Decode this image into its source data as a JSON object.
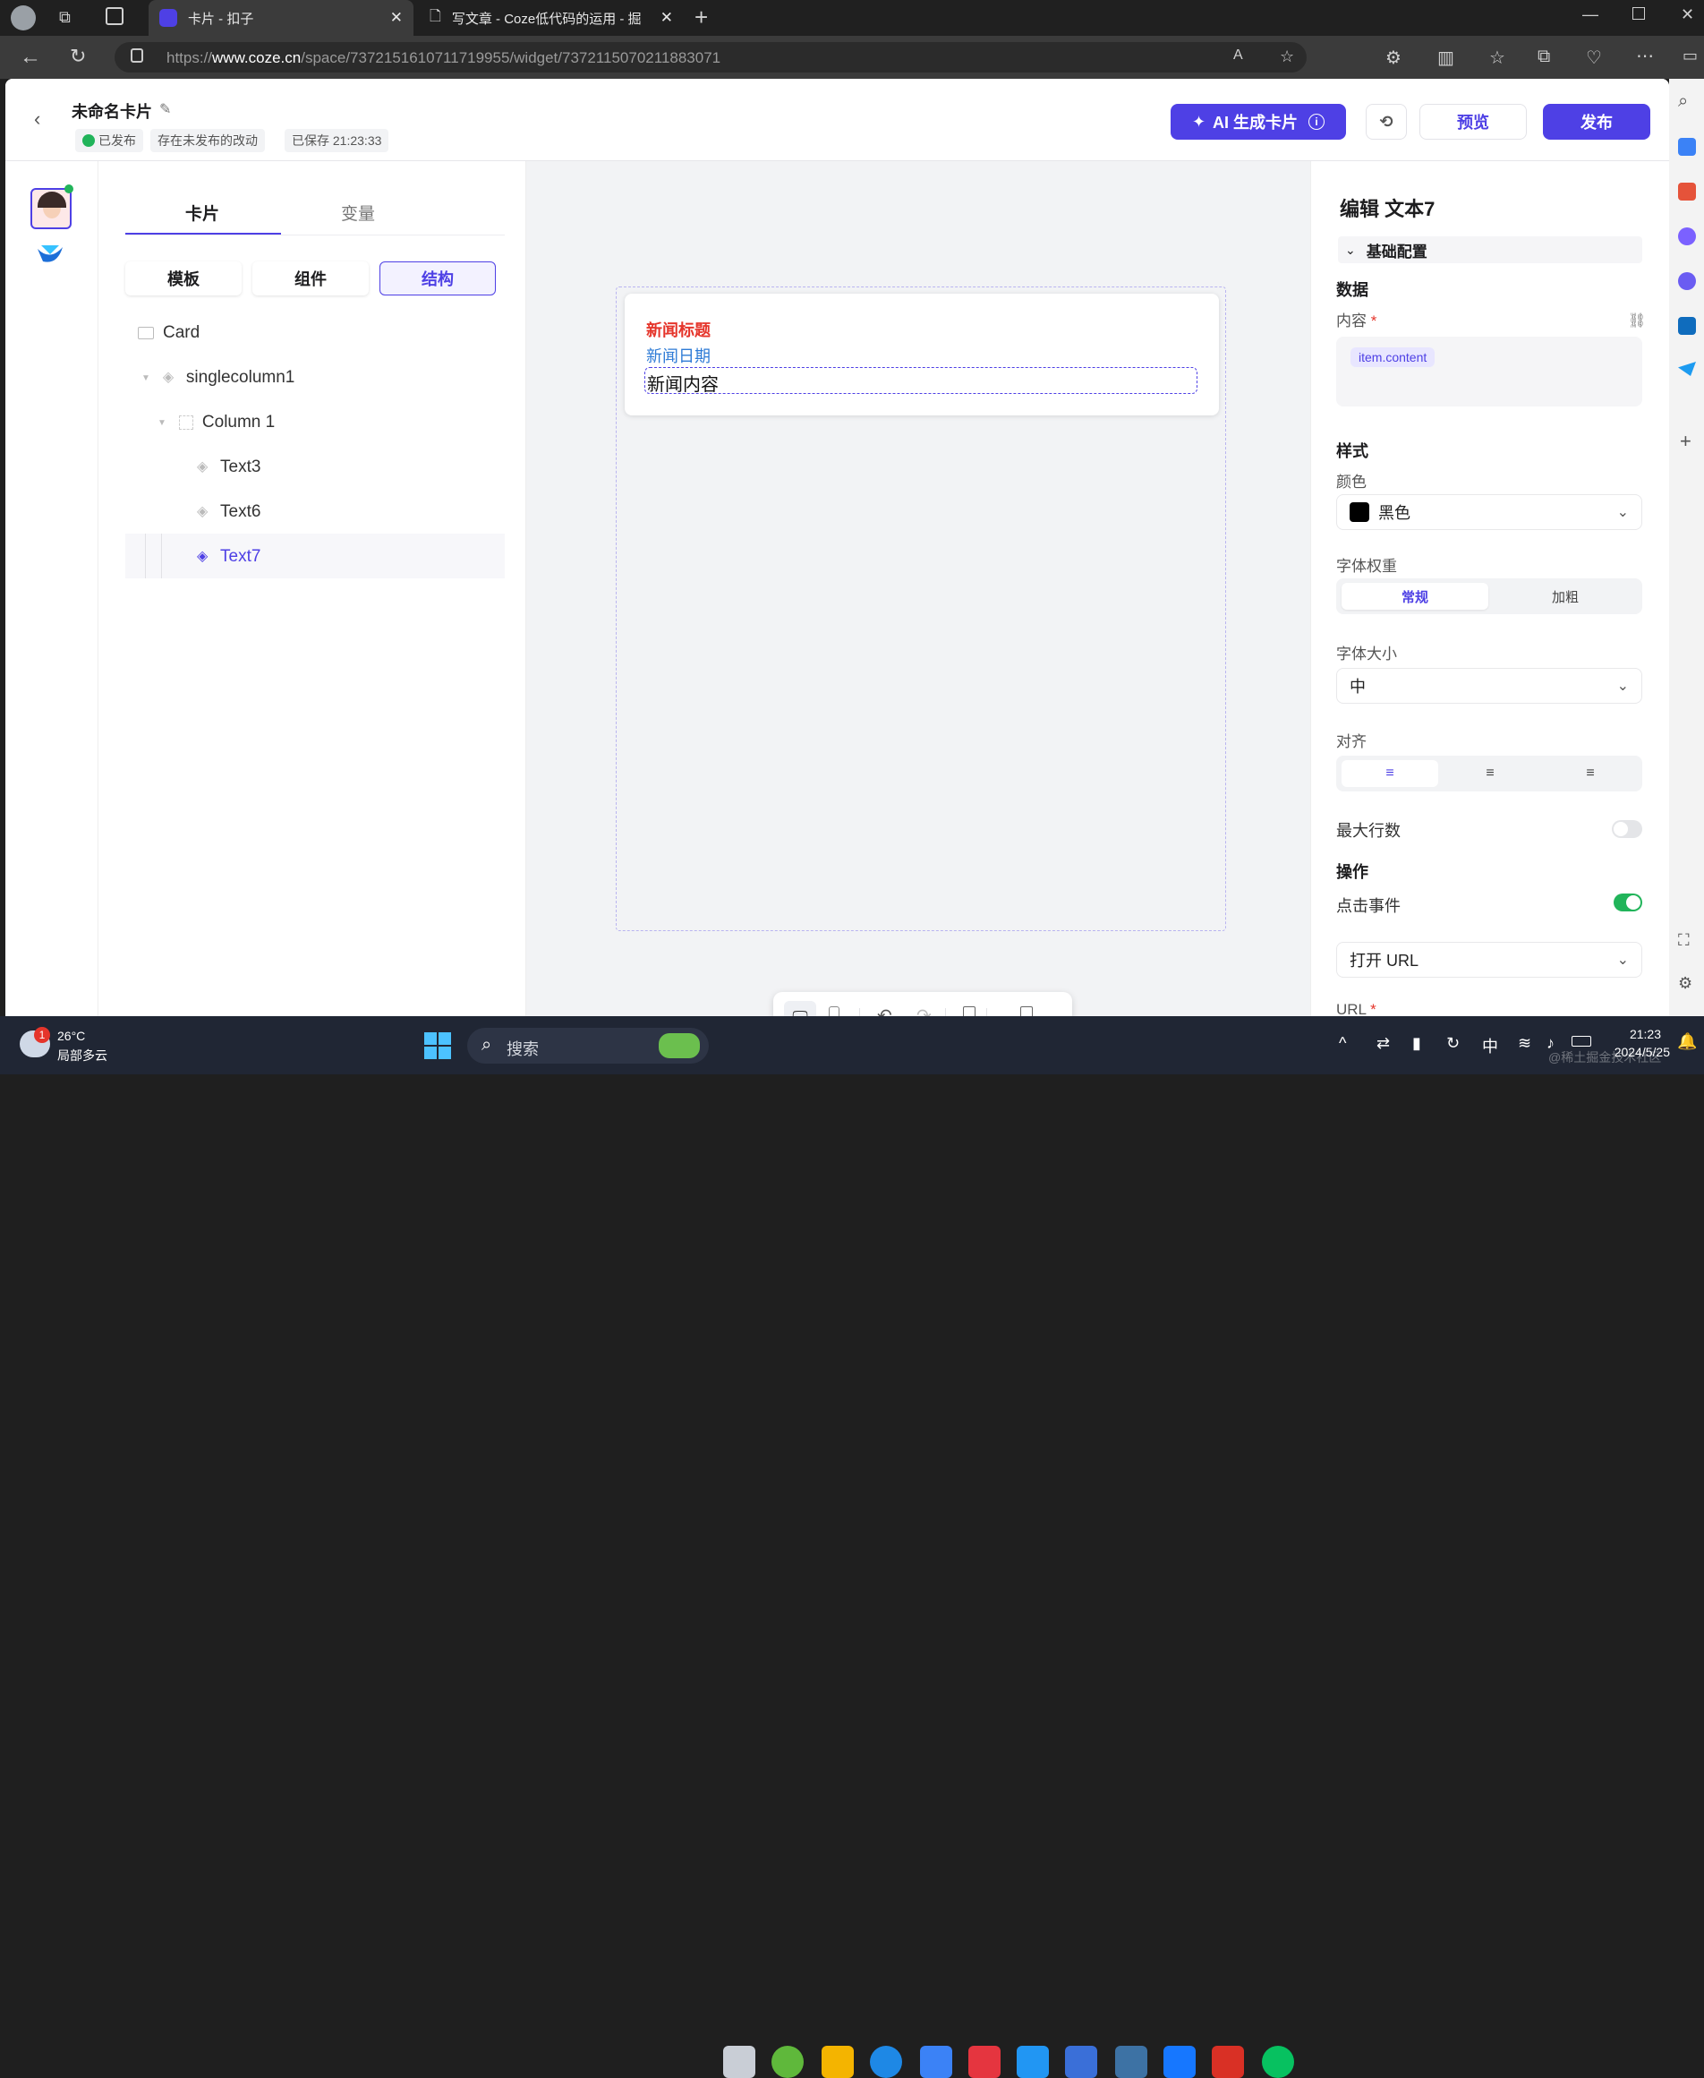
{
  "browser": {
    "tabs": [
      {
        "title": "卡片 - 扣子",
        "active": true
      },
      {
        "title": "写文章 - Coze低代码的运用 - 掘",
        "active": false
      }
    ],
    "url_prefix": "https://",
    "url_domain": "www.coze.cn",
    "url_path": "/space/7372151610711719955/widget/7372115070211883071"
  },
  "header": {
    "title": "未命名卡片",
    "status_published": "已发布",
    "status_unpublished": "存在未发布的改动",
    "status_saved": "已保存 21:23:33",
    "ai_button": "AI 生成卡片",
    "preview_button": "预览",
    "publish_button": "发布"
  },
  "left_panel": {
    "tabs": [
      "卡片",
      "变量"
    ],
    "segments": [
      "模板",
      "组件",
      "结构"
    ],
    "tree": [
      {
        "label": "Card"
      },
      {
        "label": "singlecolumn1"
      },
      {
        "label": "Column 1"
      },
      {
        "label": "Text3"
      },
      {
        "label": "Text6"
      },
      {
        "label": "Text7"
      }
    ]
  },
  "canvas": {
    "card": {
      "title": "新闻标题",
      "date": "新闻日期",
      "content": "新闻内容"
    }
  },
  "right_panel": {
    "title": "编辑 文本7",
    "section_basic": "基础配置",
    "data_heading": "数据",
    "content_label": "内容",
    "required_mark": "*",
    "content_tag": "item.content",
    "style_heading": "样式",
    "color_label": "颜色",
    "color_value": "黑色",
    "weight_label": "字体权重",
    "weight_options": [
      "常规",
      "加粗"
    ],
    "size_label": "字体大小",
    "size_value": "中",
    "align_label": "对齐",
    "maxlines_label": "最大行数",
    "action_heading": "操作",
    "click_label": "点击事件",
    "click_enabled": true,
    "action_value": "打开 URL",
    "url_label": "URL"
  },
  "taskbar": {
    "weather_temp": "26°C",
    "weather_desc": "局部多云",
    "weather_badge": "1",
    "search_placeholder": "搜索",
    "ime": "中",
    "time": "21:23",
    "date": "2024/5/25",
    "watermark": "@稀土掘金技术社区"
  },
  "colors": {
    "brand": "#4e40e5",
    "card_title": "#e5352b",
    "card_date": "#2e7bd6",
    "toggle_on": "#21b45a"
  }
}
